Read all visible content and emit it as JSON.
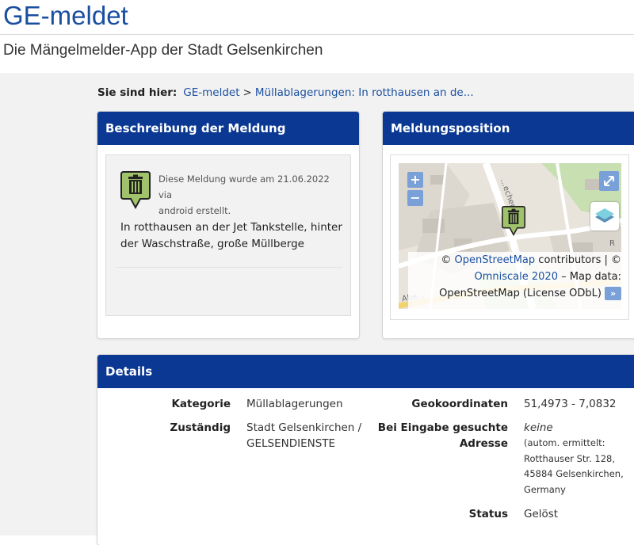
{
  "site": {
    "title": "GE-meldet",
    "subtitle": "Die Mängelmelder-App der Stadt Gelsenkirchen"
  },
  "breadcrumb": {
    "label": "Sie sind hier:",
    "home": "GE-meldet",
    "separator": ">",
    "current": "Müllablagerungen: In rotthausen an de..."
  },
  "description_panel": {
    "title": "Beschreibung der Meldung",
    "icon": "trash-can-icon",
    "meta_line1": "Diese Meldung wurde am 21.06.2022 via",
    "meta_line2": "android erstellt.",
    "text_line1": "In rotthausen an der Jet Tankstelle, hinter",
    "text_line2": "der Waschstraße, große Müllberge"
  },
  "position_panel": {
    "title": "Meldungsposition",
    "zoom_in": "+",
    "zoom_out": "−",
    "street_label": "…echenst…",
    "street_label2": "Abe…",
    "street_label3": "R",
    "attribution": {
      "copy1": "©",
      "osm_link": "OpenStreetMap",
      "contributors": "contributors | ©",
      "omniscale_link": "Omniscale 2020",
      "map_data": "– Map data:",
      "license": "OpenStreetMap (License ODbL)",
      "toggle": "»"
    }
  },
  "details": {
    "title": "Details",
    "category_label": "Kategorie",
    "category_value": "Müllablagerungen",
    "responsible_label": "Zuständig",
    "responsible_value_line1": "Stadt Gelsenkirchen /",
    "responsible_value_line2": "GELSENDIENSTE",
    "geo_label": "Geokoordinaten",
    "geo_value": "51,4973 - 7,0832",
    "address_label_line1": "Bei Eingabe gesuchte",
    "address_label_line2": "Adresse",
    "address_value": "keine",
    "address_auto_line1": "(autom. ermittelt:",
    "address_auto_line2": "Rotthauser Str. 128,",
    "address_auto_line3": "45884 Gelsenkirchen,",
    "address_auto_line4": "Germany",
    "status_label": "Status",
    "status_value": "Gelöst"
  },
  "colors": {
    "brand_blue": "#0a3893",
    "link_blue": "#1a4fa0",
    "marker_green": "#9fc26a"
  }
}
